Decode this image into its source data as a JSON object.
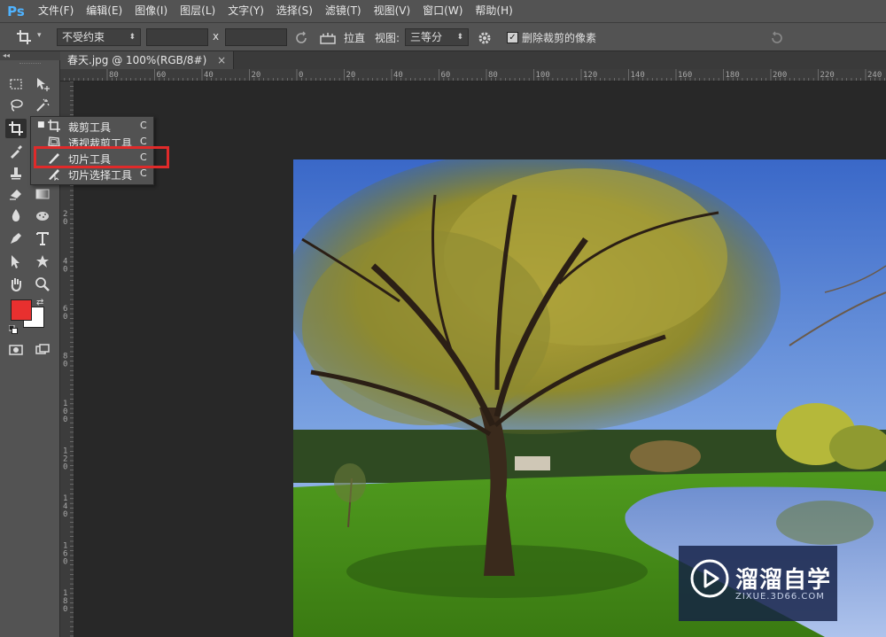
{
  "app": {
    "logo": "Ps"
  },
  "menu": [
    "文件(F)",
    "编辑(E)",
    "图像(I)",
    "图层(L)",
    "文字(Y)",
    "选择(S)",
    "滤镜(T)",
    "视图(V)",
    "窗口(W)",
    "帮助(H)"
  ],
  "options": {
    "tool_icon": "crop-icon",
    "ratio_value": "不受约束",
    "width_value": "",
    "height_value": "",
    "times_label": "x",
    "straighten_label": "拉直",
    "view_label": "视图:",
    "view_value": "三等分",
    "delete_pixels_label": "删除裁剪的像素",
    "delete_pixels_checked": true
  },
  "document": {
    "tab_title": "春天.jpg @ 100%(RGB/8#)",
    "close": "×"
  },
  "ruler_top": [
    "80",
    "60",
    "40",
    "20",
    "0",
    "20",
    "40",
    "60",
    "80",
    "100",
    "120",
    "140",
    "160",
    "180",
    "200",
    "220",
    "240"
  ],
  "ruler_left": [
    "2",
    "4",
    "6",
    "8",
    "10",
    "12",
    "14",
    "16",
    "18"
  ],
  "flyout": {
    "items": [
      {
        "label": "裁剪工具",
        "key": "C",
        "icon": "crop-icon",
        "selected": true
      },
      {
        "label": "透视裁剪工具",
        "key": "C",
        "icon": "perspective-crop-icon",
        "selected": false
      },
      {
        "label": "切片工具",
        "key": "C",
        "icon": "slice-icon",
        "selected": false
      },
      {
        "label": "切片选择工具",
        "key": "C",
        "icon": "slice-select-icon",
        "selected": false
      }
    ]
  },
  "colors": {
    "foreground": "#e8302f",
    "background": "#ffffff",
    "highlight": "#e02a2a"
  },
  "watermark": {
    "title": "溜溜自学",
    "subtitle": "ZIXUE.3D66.COM"
  }
}
